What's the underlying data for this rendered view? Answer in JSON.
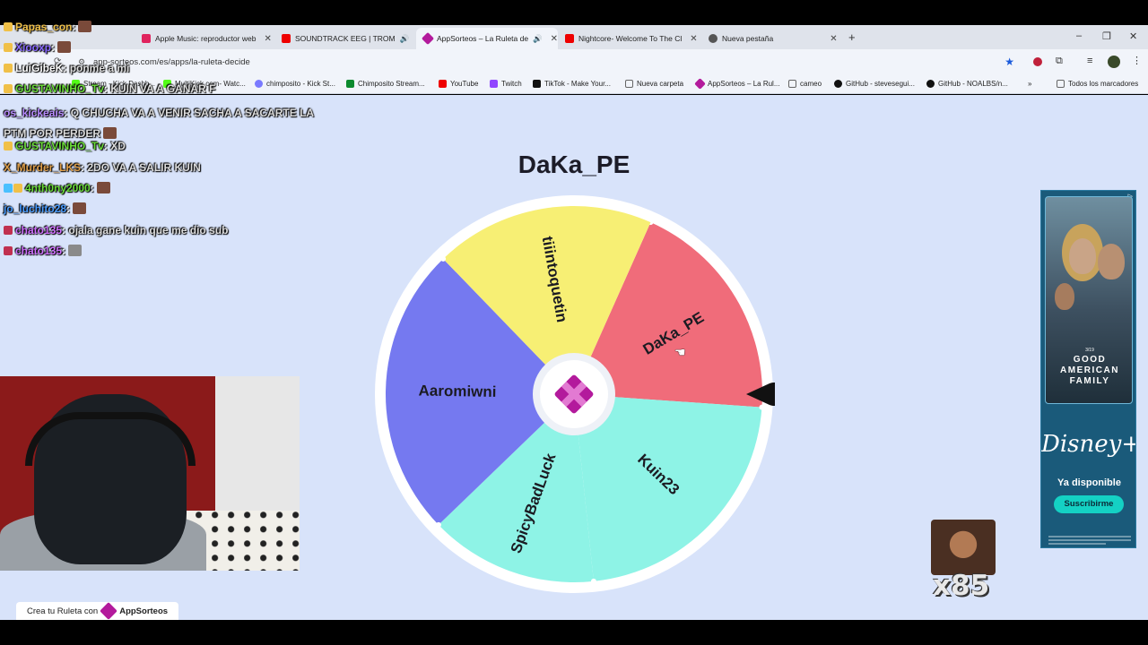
{
  "browser": {
    "tabs": [
      {
        "label": "Apple Music: reproductor web",
        "color": "#e0245e",
        "audio": false,
        "active": false
      },
      {
        "label": "SOUNDTRACK EEG | TROM",
        "color": "#e00",
        "audio": true,
        "active": false
      },
      {
        "label": "AppSorteos – La Ruleta de",
        "color": "#b31a9c",
        "audio": true,
        "active": true
      },
      {
        "label": "Nightcore- Welcome To The Cl",
        "color": "#e00",
        "audio": false,
        "active": false
      },
      {
        "label": "Nueva pestaña",
        "color": "#555",
        "audio": false,
        "active": false
      }
    ],
    "url": "app-sorteos.com/es/apps/la-ruleta-decide",
    "bookmarks": [
      {
        "label": "Stream - Kick Dashb...",
        "color": "#53fc18"
      },
      {
        "label": "MultiKick.com- Watc...",
        "color": "#53fc18"
      },
      {
        "label": "chimposito - Kick St...",
        "color": "#7a7aff"
      },
      {
        "label": "Chimposito Stream...",
        "color": "#0c8a2e"
      },
      {
        "label": "YouTube",
        "color": "#e00"
      },
      {
        "label": "Twitch",
        "color": "#9146ff"
      },
      {
        "label": "TikTok - Make Your...",
        "color": "#111"
      },
      {
        "label": "Nueva carpeta",
        "color": "#666"
      },
      {
        "label": "AppSorteos – La Rul...",
        "color": "#b31a9c"
      },
      {
        "label": "cameo",
        "color": "#666"
      },
      {
        "label": "GitHub - stevesegui...",
        "color": "#111"
      },
      {
        "label": "GitHub - NOALBS/n...",
        "color": "#111"
      }
    ],
    "all_bookmarks": "Todos los marcadores"
  },
  "wheel": {
    "winner": "DaKa_PE",
    "segments": [
      {
        "name": "DaKa_PE",
        "color": "#f06c7a"
      },
      {
        "name": "Kuin23",
        "color": "#8ef3e6"
      },
      {
        "name": "SpicyBadLuck",
        "color": "#8ef3e6"
      },
      {
        "name": "Aaromiwni",
        "color": "#7579f0"
      },
      {
        "name": "tiiintoquetin",
        "color": "#f7ef74"
      }
    ]
  },
  "ad": {
    "show": "GOOD AMERICAN FAMILY",
    "date_tag": "3/19",
    "brand": "Disney+",
    "available": "Ya disponible",
    "button": "Suscribirme"
  },
  "footer": {
    "text": "Crea tu Ruleta con",
    "brand": "AppSorteos"
  },
  "chat": [
    {
      "user": "Papas_con",
      "color": "#f0c048",
      "message": ""
    },
    {
      "user": "Xiooxp",
      "color": "#8a6bff",
      "message": ""
    },
    {
      "user": "LuiGibeK",
      "color": "#ffffff",
      "message": "ponme a mi"
    },
    {
      "user": "GUSTAVINHO_Tv",
      "color": "#6bdc3a",
      "message": "KUIN VA A GANAR F"
    },
    {
      "user": "os_kickeais",
      "color": "#b88cff",
      "message": "Q CHUCHA VA A VENIR SACHA A SACARTE LA PTM POR PERDER"
    },
    {
      "user": "GUSTAVINHO_Tv",
      "color": "#6bdc3a",
      "message": "XD"
    },
    {
      "user": "X_Murder_LKS",
      "color": "#e0a04c",
      "message": "2DO VA A SALIR KUIN"
    },
    {
      "user": "4nth0ny2000",
      "color": "#6bdc3a",
      "message": ""
    },
    {
      "user": "jo_luchito28",
      "color": "#4a9cff",
      "message": ""
    },
    {
      "user": "chato135",
      "color": "#d070ff",
      "message": "ojala gane kuin que me dio sub"
    },
    {
      "user": "chato135",
      "color": "#d070ff",
      "message": ""
    }
  ],
  "emote_counter": "x85"
}
